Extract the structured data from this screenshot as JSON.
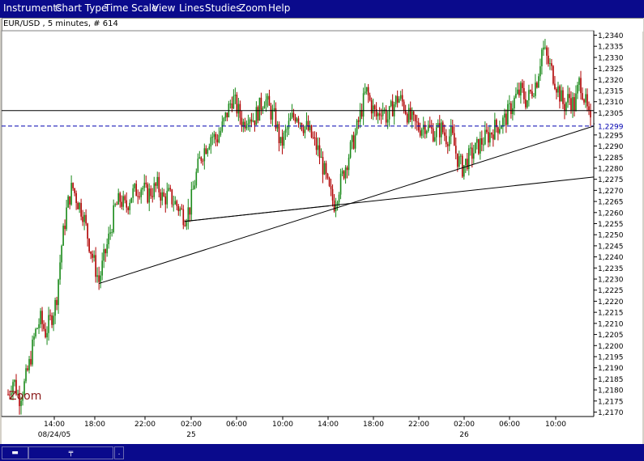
{
  "menu": [
    "Instruments",
    "Chart Type",
    "Time Scale",
    "View",
    "Lines",
    "Studies",
    "Zoom",
    "Help"
  ],
  "chart_title": "EUR/USD , 5 minutes, # 614",
  "zoom_label": "Zoom",
  "colors": {
    "menubar": "#0a0a8c",
    "up_candle": "#1a8a1a",
    "down_candle": "#b00000",
    "price_line": "#0000b0",
    "background": "#ffffff"
  },
  "chart_data": {
    "type": "candlestick",
    "title": "EUR/USD , 5 minutes, # 614",
    "y_ticks": [
      "1,2340",
      "1,2335",
      "1,2330",
      "1,2325",
      "1,2320",
      "1,2315",
      "1,2310",
      "1,2305",
      "1,2300",
      "1,2295",
      "1,2290",
      "1,2285",
      "1,2280",
      "1,2275",
      "1,2270",
      "1,2265",
      "1,2260",
      "1,2255",
      "1,2250",
      "1,2245",
      "1,2240",
      "1,2235",
      "1,2230",
      "1,2225",
      "1,2220",
      "1,2215",
      "1,2210",
      "1,2205",
      "1,2200",
      "1,2195",
      "1,2190",
      "1,2185",
      "1,2180",
      "1,2175",
      "1,2170"
    ],
    "ylim": [
      1.2168,
      1.2342
    ],
    "x_ticks": [
      {
        "label": "14:00",
        "sub": "08/24/05"
      },
      {
        "label": "18:00",
        "sub": ""
      },
      {
        "label": "22:00",
        "sub": ""
      },
      {
        "label": "02:00",
        "sub": "25"
      },
      {
        "label": "06:00",
        "sub": ""
      },
      {
        "label": "10:00",
        "sub": ""
      },
      {
        "label": "14:00",
        "sub": ""
      },
      {
        "label": "18:00",
        "sub": ""
      },
      {
        "label": "22:00",
        "sub": ""
      },
      {
        "label": "02:00",
        "sub": "26"
      },
      {
        "label": "06:00",
        "sub": ""
      },
      {
        "label": "10:00",
        "sub": ""
      }
    ],
    "current_price": 1.2299,
    "current_price_label": "1,2299",
    "horizontal_line": 1.2306,
    "price_path": [
      [
        0,
        1.2178
      ],
      [
        0.5,
        1.2185
      ],
      [
        1,
        1.2176
      ],
      [
        1.5,
        1.2182
      ],
      [
        2,
        1.2192
      ],
      [
        2.5,
        1.2205
      ],
      [
        3,
        1.2212
      ],
      [
        3.5,
        1.2206
      ],
      [
        4,
        1.2212
      ],
      [
        4.5,
        1.222
      ],
      [
        5,
        1.2245
      ],
      [
        5.5,
        1.2262
      ],
      [
        6,
        1.2272
      ],
      [
        6.5,
        1.2265
      ],
      [
        7,
        1.226
      ],
      [
        7.5,
        1.2248
      ],
      [
        8,
        1.2238
      ],
      [
        8.5,
        1.2229
      ],
      [
        9,
        1.224
      ],
      [
        9.5,
        1.225
      ],
      [
        10,
        1.2262
      ],
      [
        10.5,
        1.2266
      ],
      [
        11,
        1.2262
      ],
      [
        11.5,
        1.2268
      ],
      [
        12,
        1.227
      ],
      [
        12.5,
        1.2272
      ],
      [
        13,
        1.2268
      ],
      [
        13.5,
        1.227
      ],
      [
        14,
        1.2272
      ],
      [
        14.5,
        1.2266
      ],
      [
        15,
        1.2268
      ],
      [
        15.5,
        1.2265
      ],
      [
        16,
        1.2262
      ],
      [
        16.5,
        1.2258
      ],
      [
        17,
        1.2262
      ],
      [
        17.5,
        1.2275
      ],
      [
        18,
        1.2285
      ],
      [
        18.5,
        1.229
      ],
      [
        19,
        1.2295
      ],
      [
        19.5,
        1.2293
      ],
      [
        20,
        1.2298
      ],
      [
        20.5,
        1.2305
      ],
      [
        21,
        1.2312
      ],
      [
        21.5,
        1.2306
      ],
      [
        22,
        1.23
      ],
      [
        22.5,
        1.2305
      ],
      [
        23,
        1.2302
      ],
      [
        23.5,
        1.2307
      ],
      [
        24,
        1.2312
      ],
      [
        24.5,
        1.2306
      ],
      [
        25,
        1.2302
      ],
      [
        25.5,
        1.229
      ],
      [
        26,
        1.2296
      ],
      [
        26.5,
        1.2302
      ],
      [
        27,
        1.2305
      ],
      [
        27.5,
        1.23
      ],
      [
        28,
        1.2298
      ],
      [
        28.5,
        1.2293
      ],
      [
        29,
        1.2288
      ],
      [
        29.5,
        1.228
      ],
      [
        30,
        1.227
      ],
      [
        30.5,
        1.2264
      ],
      [
        31,
        1.2272
      ],
      [
        31.5,
        1.228
      ],
      [
        32,
        1.2288
      ],
      [
        32.5,
        1.2295
      ],
      [
        33,
        1.2305
      ],
      [
        33.5,
        1.2315
      ],
      [
        34,
        1.2308
      ],
      [
        34.5,
        1.2303
      ],
      [
        35,
        1.2308
      ],
      [
        35.5,
        1.2302
      ],
      [
        36,
        1.2308
      ],
      [
        36.5,
        1.2312
      ],
      [
        37,
        1.2309
      ],
      [
        37.5,
        1.2303
      ],
      [
        38,
        1.23
      ],
      [
        38.5,
        1.2298
      ],
      [
        39,
        1.23
      ],
      [
        39.5,
        1.2297
      ],
      [
        40,
        1.2296
      ],
      [
        40.5,
        1.2298
      ],
      [
        41,
        1.2294
      ],
      [
        41.5,
        1.2295
      ],
      [
        42,
        1.2285
      ],
      [
        42.5,
        1.228
      ],
      [
        43,
        1.2284
      ],
      [
        43.5,
        1.2287
      ],
      [
        44,
        1.229
      ],
      [
        44.5,
        1.2293
      ],
      [
        45,
        1.2295
      ],
      [
        45.5,
        1.2298
      ],
      [
        46,
        1.23
      ],
      [
        46.5,
        1.2302
      ],
      [
        47,
        1.2307
      ],
      [
        47.5,
        1.2312
      ],
      [
        48,
        1.2315
      ],
      [
        48.5,
        1.231
      ],
      [
        49,
        1.2315
      ],
      [
        49.5,
        1.232
      ],
      [
        50,
        1.2335
      ],
      [
        50.5,
        1.2328
      ],
      [
        51,
        1.2322
      ],
      [
        51.5,
        1.2315
      ],
      [
        52,
        1.2308
      ],
      [
        52.5,
        1.2312
      ],
      [
        53,
        1.2308
      ],
      [
        53.5,
        1.232
      ],
      [
        54,
        1.231
      ],
      [
        54.5,
        1.2299
      ]
    ],
    "trendlines": [
      {
        "from": [
          8.5,
          1.2228
        ],
        "to": [
          54.5,
          1.2299
        ]
      },
      {
        "from": [
          16.5,
          1.2256
        ],
        "to": [
          54.5,
          1.2276
        ]
      }
    ]
  },
  "statusbar": {
    "cell1": "",
    "cell2": "",
    "cell3": ""
  }
}
